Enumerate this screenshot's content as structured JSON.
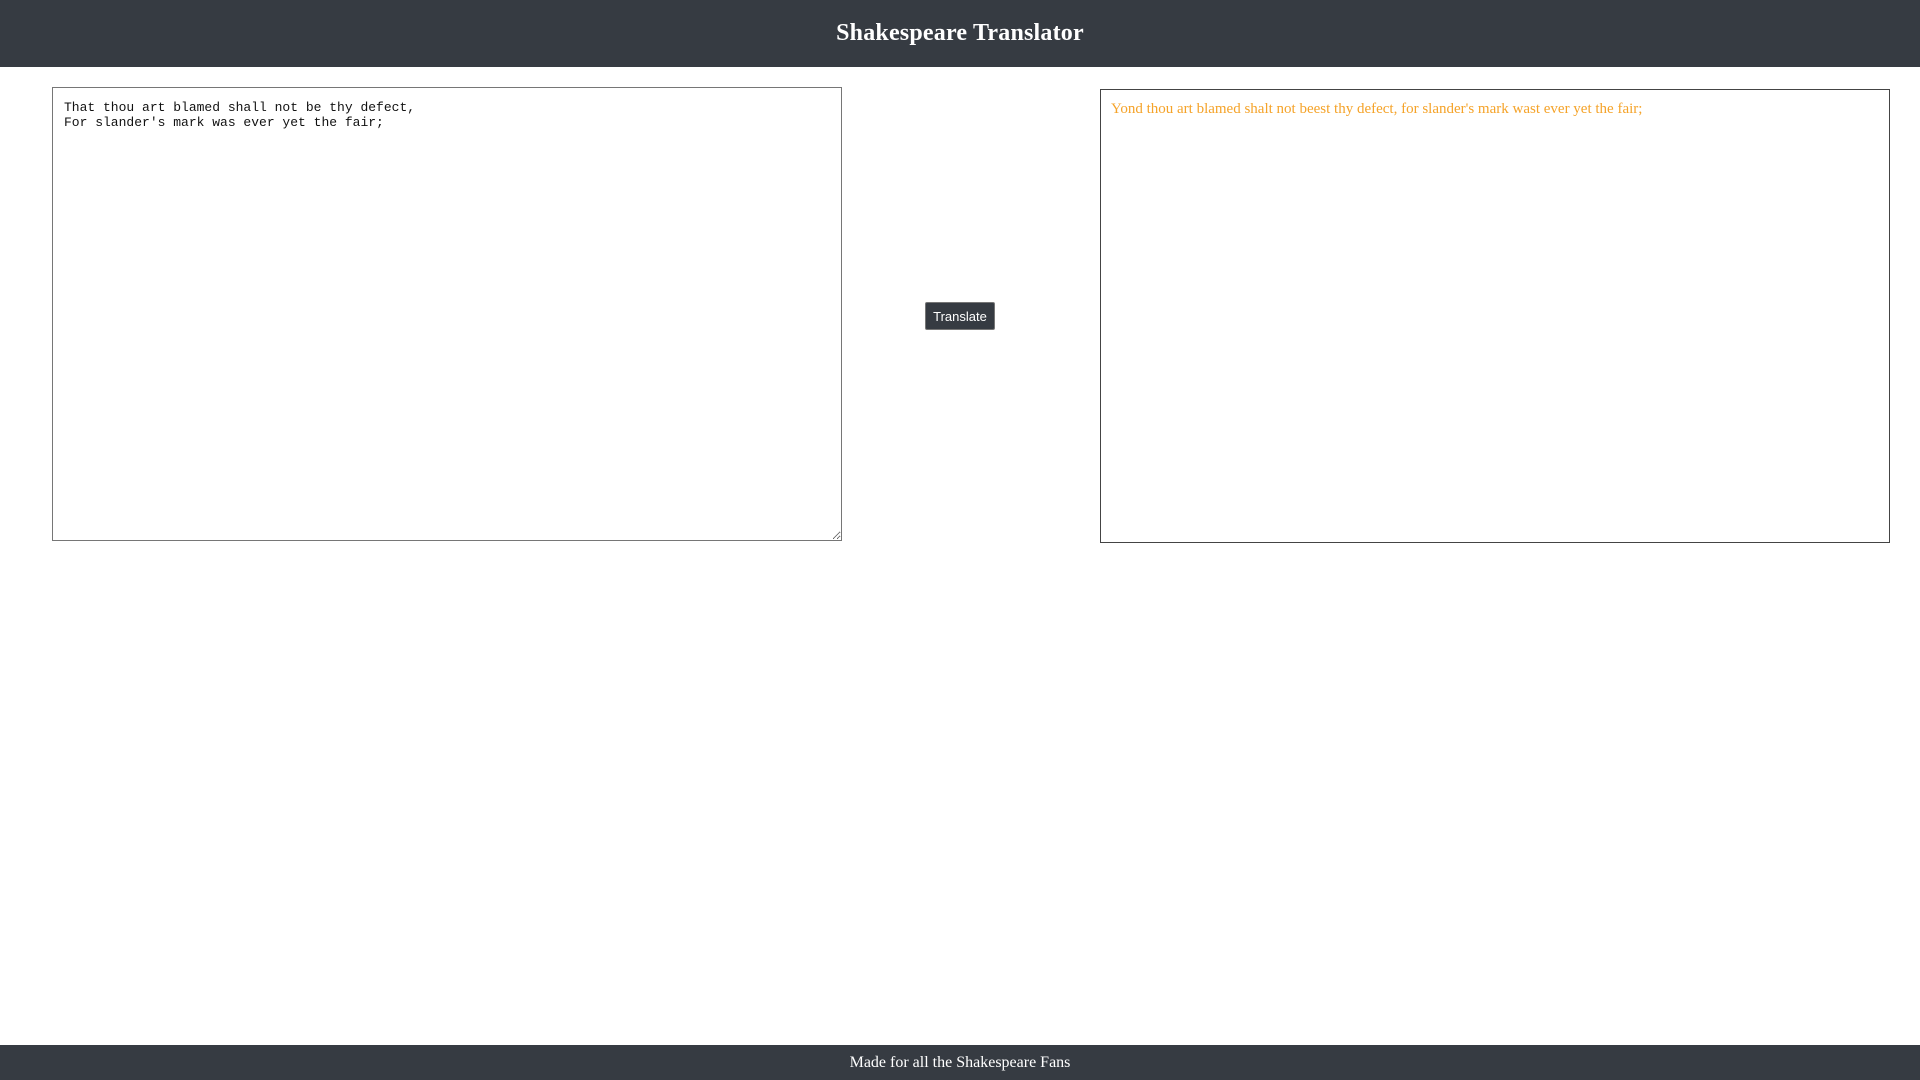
{
  "header": {
    "title": "Shakespeare Translator"
  },
  "input": {
    "value": "That thou art blamed shall not be thy defect,\nFor slander's mark was ever yet the fair;"
  },
  "translate_button": {
    "label": "Translate"
  },
  "output": {
    "text": "Yond thou art blamed shalt not beest thy defect, for slander's mark wast ever yet the fair;"
  },
  "footer": {
    "text": "Made for all the Shakespeare Fans"
  },
  "colors": {
    "bar_background": "#363b42",
    "output_text": "#f5a329"
  }
}
